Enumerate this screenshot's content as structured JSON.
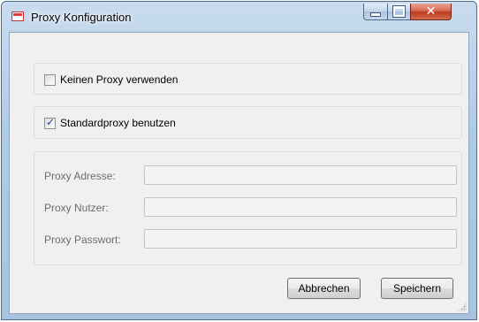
{
  "window": {
    "title": "Proxy Konfiguration",
    "controls": {
      "minimize": "minimize",
      "maximize": "maximize",
      "close": "✕"
    }
  },
  "options": {
    "no_proxy": {
      "label": "Keinen Proxy verwenden",
      "checked": false
    },
    "default_proxy": {
      "label": "Standardproxy benutzen",
      "checked": true
    }
  },
  "fields": [
    {
      "label": "Proxy Adresse:",
      "value": ""
    },
    {
      "label": "Proxy Nutzer:",
      "value": ""
    },
    {
      "label": "Proxy Passwort:",
      "value": ""
    }
  ],
  "buttons": {
    "cancel": "Abbrechen",
    "save": "Speichern"
  },
  "colors": {
    "title_bar": "#b2cbe5",
    "client_background": "#f0f0f0",
    "close_button": "#c0391f"
  }
}
